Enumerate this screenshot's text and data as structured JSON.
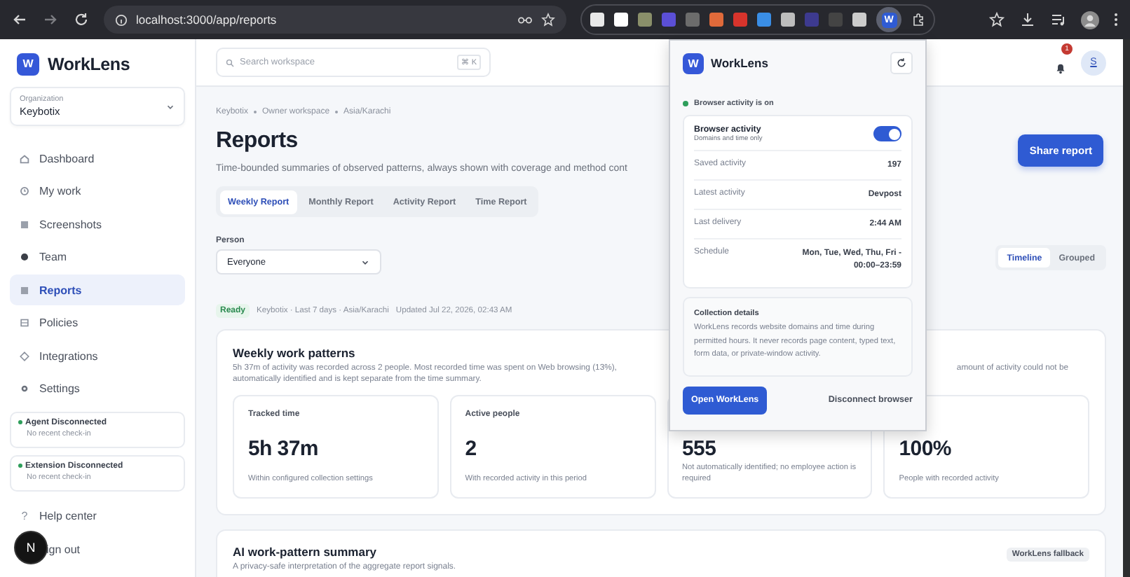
{
  "browser": {
    "url": "localhost:3000/app/reports",
    "active_extension_letter": "W"
  },
  "sidebar": {
    "logo_letter": "W",
    "brand": "WorkLens",
    "organization": {
      "label": "Organization",
      "value": "Keybotix"
    },
    "nav": [
      {
        "label": "Dashboard",
        "kind": "home",
        "selected": false
      },
      {
        "label": "My work",
        "kind": "clock",
        "selected": false
      },
      {
        "label": "Screenshots",
        "kind": "square",
        "selected": false
      },
      {
        "label": "Team",
        "kind": "dot",
        "selected": false
      },
      {
        "label": "Reports",
        "kind": "square",
        "selected": true
      },
      {
        "label": "Policies",
        "kind": "grid",
        "selected": false
      },
      {
        "label": "Integrations",
        "kind": "diamond",
        "selected": false
      },
      {
        "label": "Settings",
        "kind": "gear",
        "selected": false
      }
    ],
    "status_cards": [
      {
        "title": "Agent Disconnected",
        "subtitle": "No recent check-in",
        "color": "#2e9e5b"
      },
      {
        "title": "Extension Disconnected",
        "subtitle": "No recent check-in",
        "color": "#2e9e5b"
      }
    ],
    "help": {
      "glyph": "?",
      "label": "Help center"
    },
    "sign_out": {
      "label": "ign out"
    },
    "dev_indicator": {
      "letter": "N"
    }
  },
  "header": {
    "search": {
      "placeholder": "Search workspace",
      "shortcut": "⌘ K"
    },
    "notification_count": "1",
    "avatar_letter": "S"
  },
  "page": {
    "breadcrumb": [
      "Keybotix",
      "Owner workspace",
      "Asia/Karachi"
    ],
    "title": "Reports",
    "description": "Time-bounded summaries of observed patterns, always shown with coverage and method cont",
    "share_button": "Share report",
    "tabs": [
      {
        "label": "Weekly Report",
        "selected": true
      },
      {
        "label": "Monthly Report",
        "selected": false
      },
      {
        "label": "Activity Report",
        "selected": false
      },
      {
        "label": "Time Report",
        "selected": false
      }
    ],
    "person": {
      "label": "Person",
      "value": "Everyone"
    },
    "status": {
      "badge": "Ready",
      "meta": "Keybotix · Last 7 days · Asia/Karachi",
      "updated": "Updated Jul 22, 2026, 02:43 AM"
    },
    "view_toggle": [
      {
        "label": "Timeline",
        "selected": true
      },
      {
        "label": "Grouped",
        "selected": false
      }
    ]
  },
  "weekly_card": {
    "title": "Weekly work patterns",
    "description_parts": [
      "5h 37m of activity was recorded across 2 people. Most recorded time was spent on Web browsing (13%),",
      "amount of activity could not be",
      "automatically identified and is kept separate from the time summary."
    ],
    "stats": [
      {
        "label": "Tracked time",
        "value": "5h 37m",
        "note": "Within configured collection settings"
      },
      {
        "label": "Active people",
        "value": "2",
        "note": "With recorded activity in this period"
      },
      {
        "value": "555",
        "note": "Not automatically identified; no employee action is required"
      },
      {
        "value": "100%",
        "note": "People with recorded activity"
      }
    ]
  },
  "ai_card": {
    "title": "AI work-pattern summary",
    "subtitle": "A privacy-safe interpretation of the aggregate report signals.",
    "badge": "WorkLens fallback"
  },
  "popup": {
    "logo_letter": "W",
    "brand": "WorkLens",
    "status": {
      "text": "Browser activity is on",
      "color": "#2e9e5b"
    },
    "activity": {
      "title": "Browser activity",
      "subtitle": "Domains and time only",
      "on": true
    },
    "rows": [
      {
        "label": "Saved activity",
        "value": "197"
      },
      {
        "label": "Latest activity",
        "value": "Devpost"
      },
      {
        "label": "Last delivery",
        "value": "2:44 AM"
      },
      {
        "label": "Schedule",
        "value": "Mon, Tue, Wed, Thu, Fri - 00:00–23:59"
      }
    ],
    "details": {
      "title": "Collection details",
      "text": "WorkLens records website domains and time during permitted hours. It never records page content, typed text, form data, or private-window activity."
    },
    "primary_button": "Open WorkLens",
    "secondary_button": "Disconnect browser"
  }
}
